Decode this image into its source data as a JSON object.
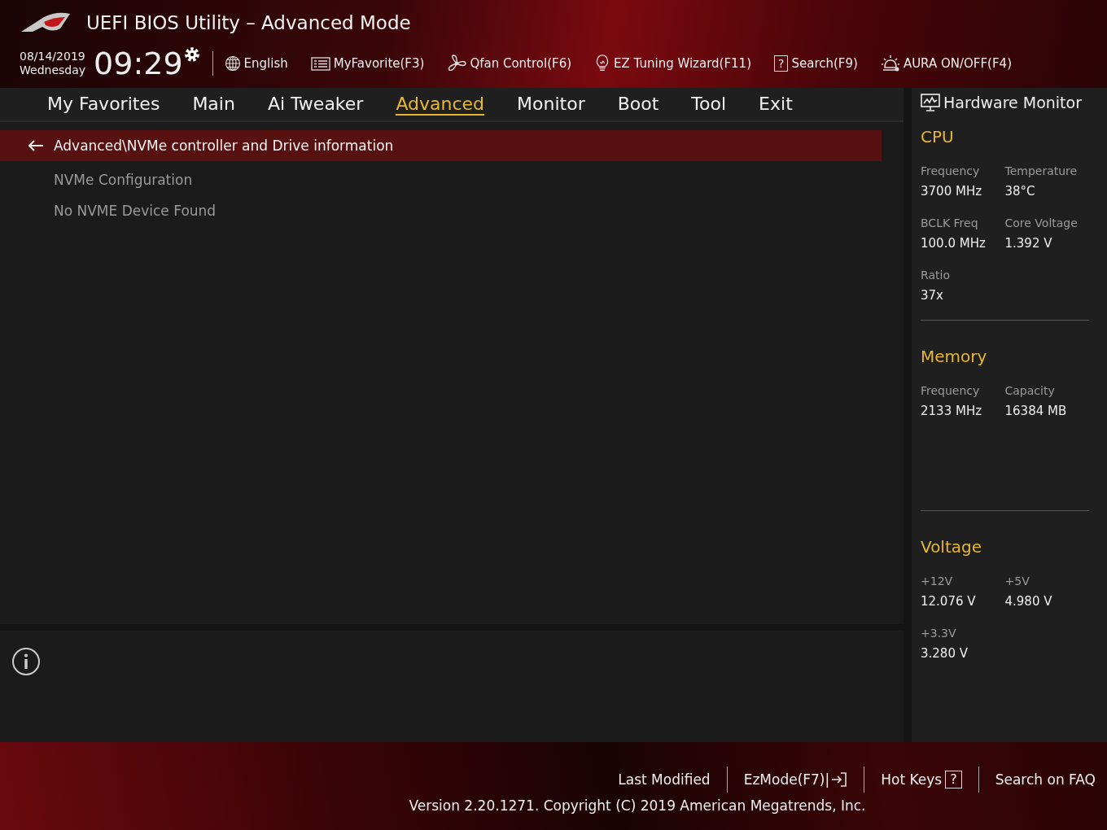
{
  "header": {
    "title": "UEFI BIOS Utility – Advanced Mode",
    "date": "08/14/2019",
    "day": "Wednesday",
    "time": "09:29",
    "tools": [
      {
        "kind": "language",
        "label": "English"
      },
      {
        "kind": "favorite",
        "label": "MyFavorite(F3)"
      },
      {
        "kind": "fan",
        "label": "Qfan Control(F6)"
      },
      {
        "kind": "wizard",
        "label": "EZ Tuning Wizard(F11)"
      },
      {
        "kind": "search",
        "label": "Search(F9)",
        "icon_text": "?"
      },
      {
        "kind": "aura",
        "label": "AURA ON/OFF(F4)"
      }
    ]
  },
  "tabs": [
    {
      "label": "My Favorites",
      "selected": false
    },
    {
      "label": "Main",
      "selected": false
    },
    {
      "label": "Ai Tweaker",
      "selected": false
    },
    {
      "label": "Advanced",
      "selected": true
    },
    {
      "label": "Monitor",
      "selected": false
    },
    {
      "label": "Boot",
      "selected": false
    },
    {
      "label": "Tool",
      "selected": false
    },
    {
      "label": "Exit",
      "selected": false
    }
  ],
  "breadcrumb": "Advanced\\NVMe controller and Drive information",
  "items": [
    "NVMe Configuration",
    "No NVME Device Found"
  ],
  "hardware_monitor": {
    "title": "Hardware Monitor",
    "sections": [
      {
        "title": "CPU",
        "rows": [
          [
            {
              "label": "Frequency",
              "value": "3700 MHz"
            },
            {
              "label": "Temperature",
              "value": "38°C"
            }
          ],
          [
            {
              "label": "BCLK Freq",
              "value": "100.0 MHz"
            },
            {
              "label": "Core Voltage",
              "value": "1.392 V"
            }
          ],
          [
            {
              "label": "Ratio",
              "value": "37x"
            }
          ]
        ]
      },
      {
        "title": "Memory",
        "rows": [
          [
            {
              "label": "Frequency",
              "value": "2133 MHz"
            },
            {
              "label": "Capacity",
              "value": "16384 MB"
            }
          ]
        ]
      },
      {
        "title": "Voltage",
        "rows": [
          [
            {
              "label": "+12V",
              "value": "12.076 V"
            },
            {
              "label": "+5V",
              "value": "4.980 V"
            }
          ],
          [
            {
              "label": "+3.3V",
              "value": "3.280 V"
            }
          ]
        ]
      }
    ]
  },
  "footer": {
    "links": [
      {
        "kind": "plain",
        "label": "Last Modified"
      },
      {
        "kind": "exit",
        "label": "EzMode(F7)|"
      },
      {
        "kind": "help",
        "label": "Hot Keys",
        "icon_text": "?"
      },
      {
        "kind": "plain",
        "label": "Search on FAQ"
      }
    ],
    "copyright": "Version 2.20.1271. Copyright (C) 2019 American Megatrends, Inc."
  }
}
